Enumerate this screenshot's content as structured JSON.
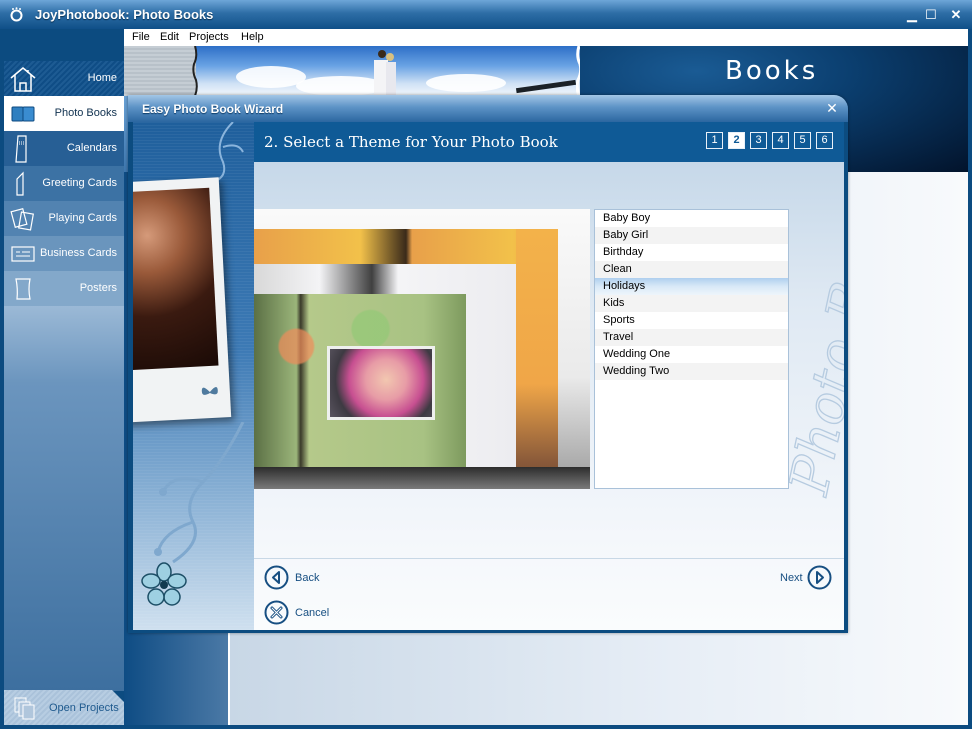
{
  "window": {
    "title": "JoyPhotobook: Photo Books",
    "controls": {
      "minimize": "▁",
      "maximize": "☐",
      "close": "✕"
    }
  },
  "menubar": {
    "items": [
      "File",
      "Edit",
      "Projects",
      "Help"
    ]
  },
  "sidebar": {
    "items": [
      {
        "label": "Home",
        "icon": "home-icon"
      },
      {
        "label": "Photo Books",
        "icon": "book-icon",
        "selected": true
      },
      {
        "label": "Calendars",
        "icon": "calendar-icon"
      },
      {
        "label": "Greeting Cards",
        "icon": "greeting-card-icon"
      },
      {
        "label": "Playing Cards",
        "icon": "playing-cards-icon"
      },
      {
        "label": "Business Cards",
        "icon": "business-card-icon"
      },
      {
        "label": "Posters",
        "icon": "poster-icon"
      }
    ],
    "open_projects": {
      "label": "Open Projects",
      "icon": "open-projects-icon"
    }
  },
  "banner": {
    "title": "Books"
  },
  "wizard": {
    "title": "Easy Photo Book Wizard",
    "close": "✕",
    "step_title": "2. Select a Theme for Your Photo Book",
    "steps": [
      "1",
      "2",
      "3",
      "4",
      "5",
      "6"
    ],
    "current_step": 2,
    "watermark": "Photo Books",
    "themes": [
      "Baby Boy",
      "Baby Girl",
      "Birthday",
      "Clean",
      "Holidays",
      "Kids",
      "Sports",
      "Travel",
      "Wedding One",
      "Wedding Two"
    ],
    "selected_theme": "Holidays",
    "buttons": {
      "back": "Back",
      "next": "Next",
      "cancel": "Cancel"
    }
  },
  "colors": {
    "accent": "#0f5a96",
    "frame": "#0c4c80",
    "link_text": "#174f82",
    "selection": "#aecfee"
  }
}
